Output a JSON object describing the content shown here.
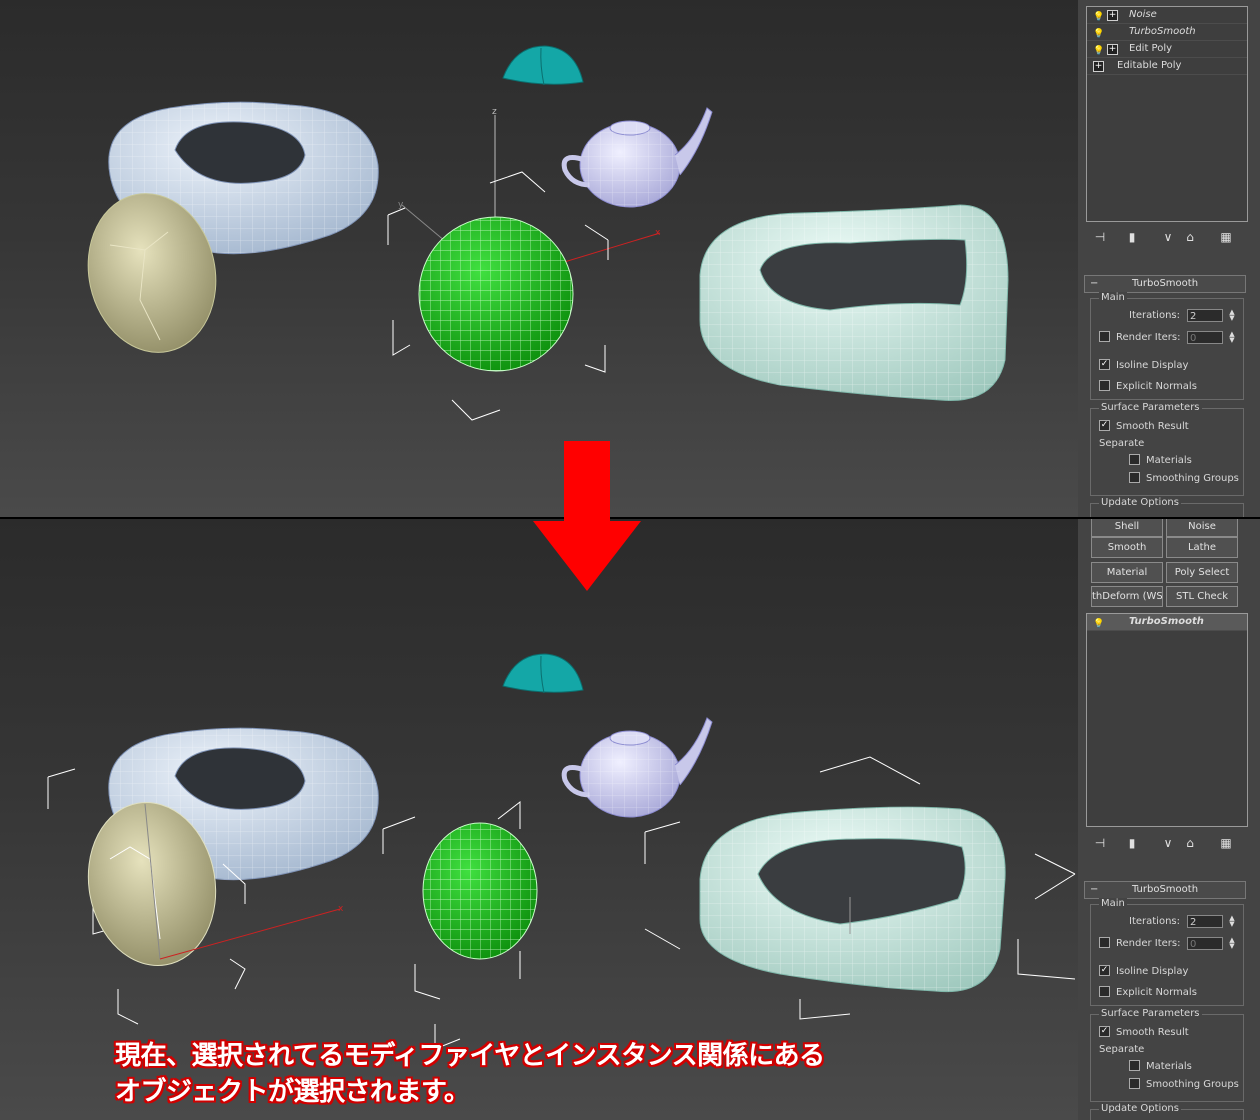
{
  "modifier_stack": {
    "items": [
      {
        "label": "Noise",
        "italic": true
      },
      {
        "label": "TurboSmooth",
        "italic": true
      },
      {
        "label": "Edit Poly",
        "italic": false
      },
      {
        "label": "Editable Poly",
        "italic": false
      }
    ],
    "selected_single": "TurboSmooth"
  },
  "toolbar": {
    "icons": [
      "pin-stack-icon",
      "show-end-result-icon",
      "make-unique-icon",
      "remove-modifier-icon",
      "configure-modifier-sets-icon"
    ]
  },
  "turbosmooth": {
    "title": "TurboSmooth",
    "main_group": "Main",
    "iterations_label": "Iterations:",
    "iterations_value": "2",
    "render_iters_label": "Render Iters:",
    "render_iters_value": "0",
    "render_iters_checked": false,
    "isoline_label": "Isoline Display",
    "isoline_checked": true,
    "explicit_normals_label": "Explicit Normals",
    "explicit_normals_checked": false,
    "surface_group": "Surface Parameters",
    "smooth_result_label": "Smooth Result",
    "smooth_result_checked": true,
    "separate_label": "Separate",
    "materials_label": "Materials",
    "smoothing_groups_label": "Smoothing Groups",
    "update_options_label": "Update Options"
  },
  "modifier_buttons": [
    [
      "Shell",
      "Noise"
    ],
    [
      "Smooth",
      "Lathe"
    ],
    [
      "Material",
      "Poly Select"
    ],
    [
      "thDeform (WSI",
      "STL Check"
    ]
  ],
  "viewport": {
    "axis_x": "x",
    "axis_y": "y",
    "axis_z": "z"
  },
  "colors": {
    "arrow": "#ff0000",
    "caption_outline": "#d00000",
    "sphere": "#1fc21f",
    "torus": "#c9d8ec",
    "box_torus": "#cdeee6",
    "egg": "#d6d2a8",
    "dome": "#14a7a7",
    "teapot": "#c8c8ea"
  },
  "caption": {
    "line1": "現在、選択されてるモディファイヤとインスタンス関係にある",
    "line2": "オブジェクトが選択されます。"
  }
}
